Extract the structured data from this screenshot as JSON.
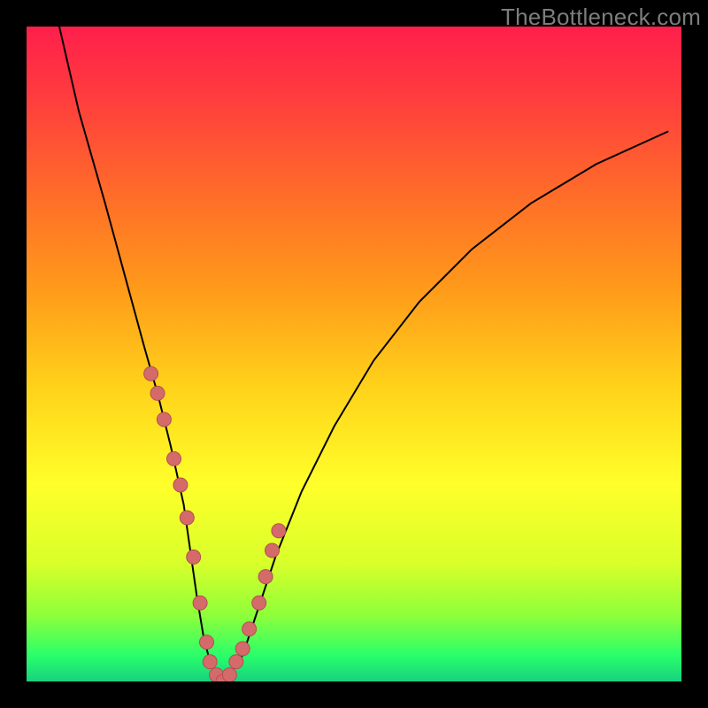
{
  "watermark": {
    "text": "TheBottleneck.com"
  },
  "colors": {
    "frame": "#000000",
    "curve": "#000000",
    "marker_fill": "#d46a6a",
    "marker_stroke": "#b24f52",
    "gradient_stops": [
      {
        "offset": 0.0,
        "color": "#ff1f4b"
      },
      {
        "offset": 0.1,
        "color": "#ff3a3f"
      },
      {
        "offset": 0.25,
        "color": "#ff6a2a"
      },
      {
        "offset": 0.4,
        "color": "#ff9a1a"
      },
      {
        "offset": 0.55,
        "color": "#ffd21a"
      },
      {
        "offset": 0.7,
        "color": "#ffff2a"
      },
      {
        "offset": 0.82,
        "color": "#d8ff2a"
      },
      {
        "offset": 0.9,
        "color": "#8dff3a"
      },
      {
        "offset": 0.96,
        "color": "#2aff6a"
      },
      {
        "offset": 1.0,
        "color": "#16d27f"
      }
    ]
  },
  "chart_data": {
    "type": "line",
    "title": "",
    "xlabel": "",
    "ylabel": "",
    "xlim": [
      0,
      100
    ],
    "ylim": [
      0,
      100
    ],
    "grid": false,
    "legend": false,
    "series": [
      {
        "name": "bottleneck-curve",
        "x": [
          5,
          8,
          12,
          15,
          18,
          20,
          22,
          24,
          25,
          26,
          27,
          28,
          29,
          30,
          31,
          33,
          35,
          38,
          42,
          47,
          53,
          60,
          68,
          77,
          87,
          98
        ],
        "y": [
          100,
          87,
          73,
          62,
          51,
          44,
          36,
          27,
          20,
          13,
          7,
          3,
          1,
          0,
          1,
          4,
          10,
          19,
          29,
          39,
          49,
          58,
          66,
          73,
          79,
          84
        ]
      }
    ],
    "markers": {
      "name": "highlighted-points",
      "x": [
        19.0,
        20.0,
        21.0,
        22.5,
        23.5,
        24.5,
        25.5,
        26.5,
        27.5,
        28.0,
        29.0,
        30.0,
        31.0,
        32.0,
        33.0,
        34.0,
        35.5,
        36.5,
        37.5,
        38.5
      ],
      "y": [
        47,
        44,
        40,
        34,
        30,
        25,
        19,
        12,
        6,
        3,
        1,
        0,
        1,
        3,
        5,
        8,
        12,
        16,
        20,
        23
      ]
    }
  }
}
